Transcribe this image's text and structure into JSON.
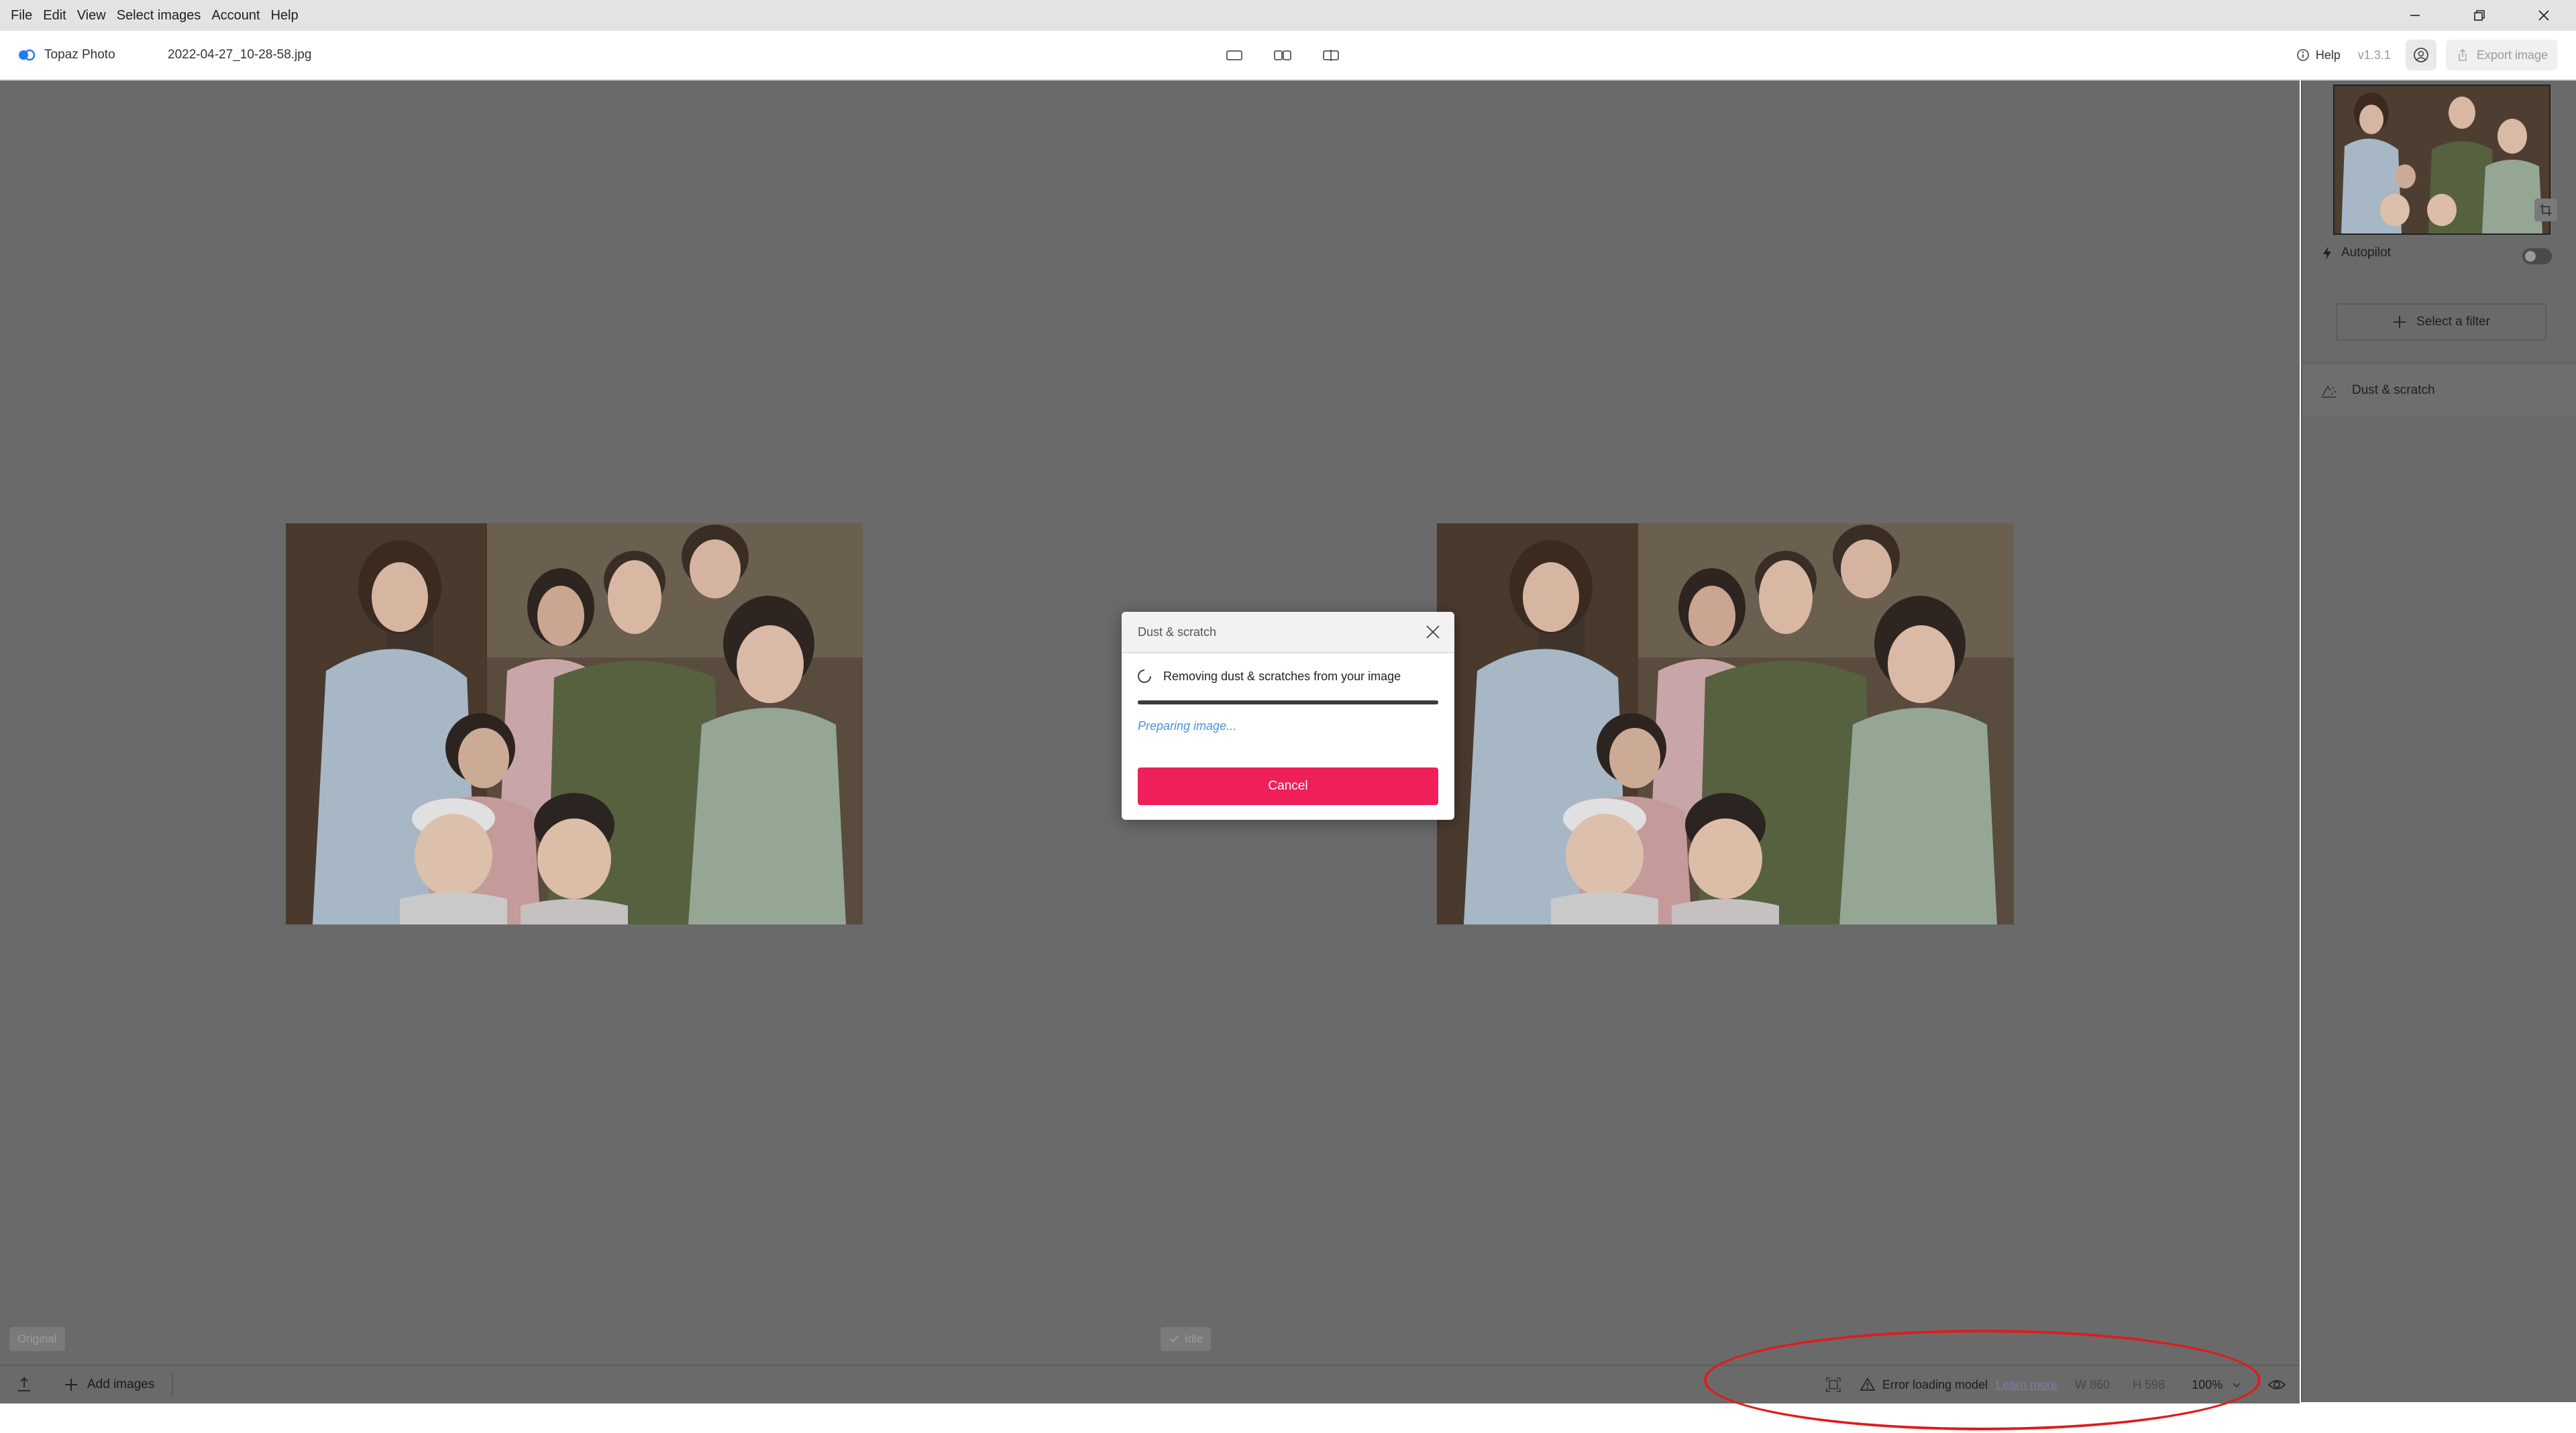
{
  "menu": {
    "items": [
      "File",
      "Edit",
      "View",
      "Select images",
      "Account",
      "Help"
    ]
  },
  "app": {
    "logo_text": "Topaz Photo",
    "file_name": "2022-04-27_10-28-58.jpg",
    "help_label": "Help",
    "version": "v1.3.1",
    "export_label": "Export image"
  },
  "canvas": {
    "original_label": "Original",
    "idle_label": "Idle"
  },
  "bottombar": {
    "add_images_label": "Add images",
    "error_text": "Error loading model",
    "learn_more": "Learn more",
    "width": "W 860",
    "height": "H 598",
    "zoom": "100%"
  },
  "panel": {
    "autopilot_label": "Autopilot",
    "autopilot_on": false,
    "select_filter_label": "Select a filter",
    "filters": [
      "Dust & scratch"
    ]
  },
  "modal": {
    "title": "Dust & scratch",
    "status": "Removing dust & scratches from your image",
    "substatus": "Preparing image...",
    "cancel_label": "Cancel",
    "progress": 1.0
  },
  "colors": {
    "accent": "#ef1f5a",
    "canvas_bg": "#6a6a6a",
    "highlight": "#e01b1b",
    "link": "#4a90d9"
  }
}
